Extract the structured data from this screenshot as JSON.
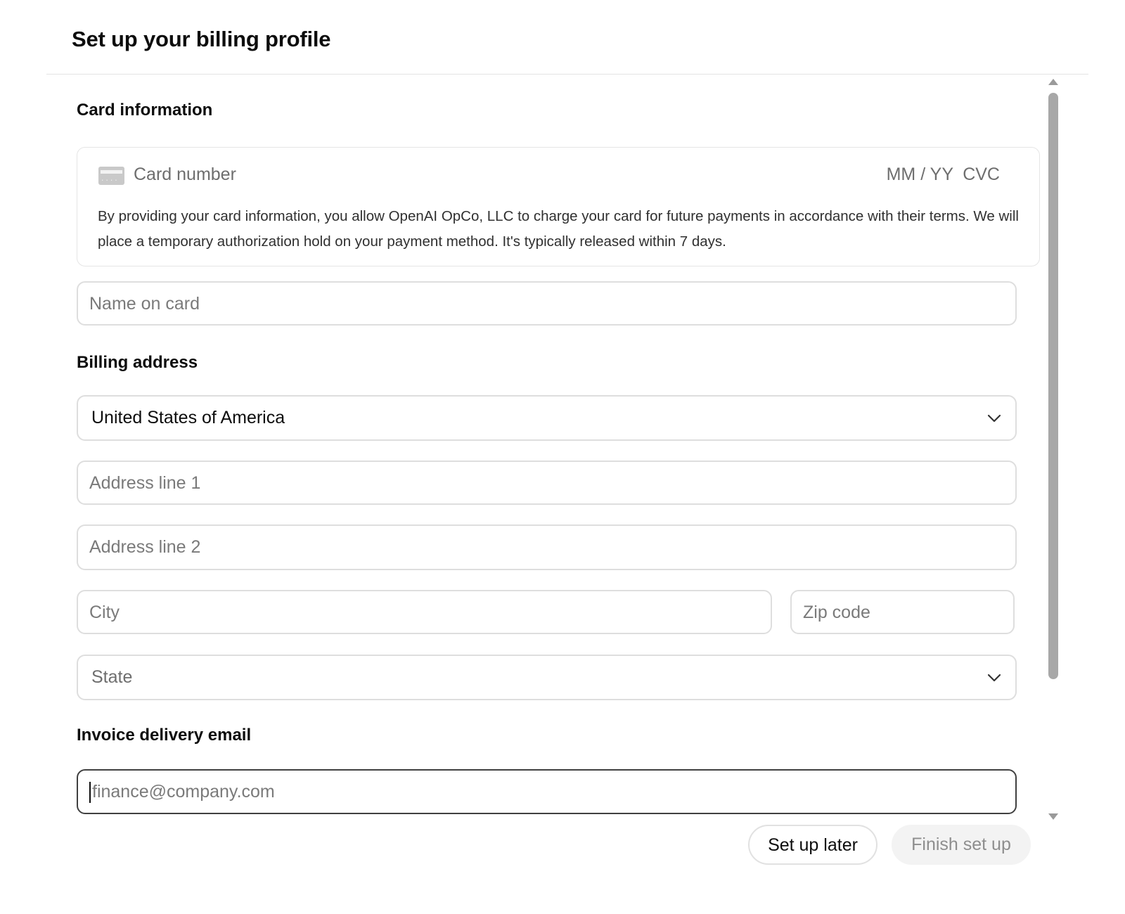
{
  "dialog": {
    "title": "Set up your billing profile"
  },
  "card_section": {
    "label": "Card information",
    "card_number_placeholder": "Card number",
    "expiry_placeholder": "MM / YY",
    "cvc_placeholder": "CVC",
    "disclaimer": "By providing your card information, you allow OpenAI OpCo, LLC to charge your card for future payments in accordance with their terms. We will place a temporary authorization hold on your payment method. It's typically released within 7 days.",
    "name_placeholder": "Name on card",
    "card_icon": "credit-card-icon"
  },
  "billing_section": {
    "label": "Billing address",
    "country_value": "United States of America",
    "address1_placeholder": "Address line 1",
    "address2_placeholder": "Address line 2",
    "city_placeholder": "City",
    "zip_placeholder": "Zip code",
    "state_placeholder": "State",
    "dropdown_icon": "chevron-down-icon"
  },
  "invoice_section": {
    "label": "Invoice delivery email",
    "email_placeholder": "finance@company.com"
  },
  "actions": {
    "later_label": "Set up later",
    "finish_label": "Finish set up"
  }
}
